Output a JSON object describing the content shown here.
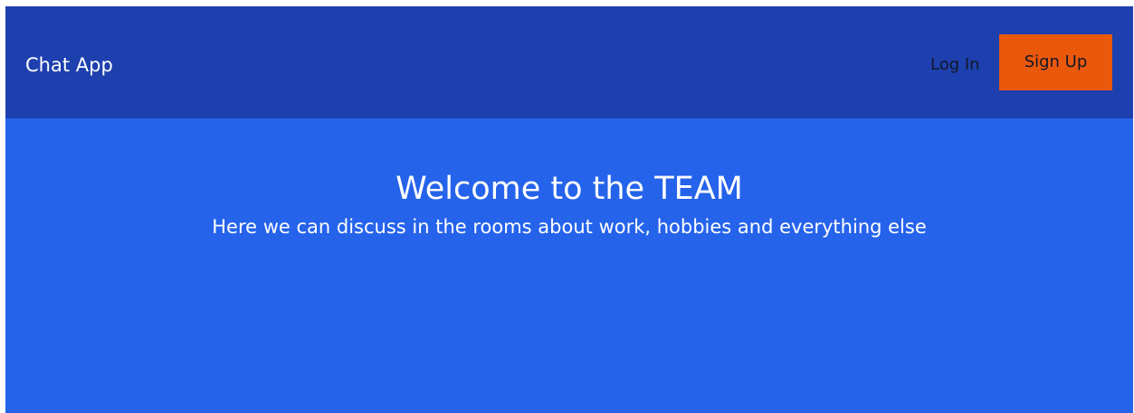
{
  "navbar": {
    "brand": "Chat App",
    "login_label": "Log In",
    "signup_label": "Sign Up"
  },
  "hero": {
    "title": "Welcome to the TEAM",
    "subtitle": "Here we can discuss in the rooms about work, hobbies and everything else"
  },
  "colors": {
    "navbar_bg": "#1e40af",
    "hero_bg": "#2563eb",
    "signup_bg": "#ea580c",
    "text_light": "#ffffff",
    "text_dark": "#111827"
  }
}
